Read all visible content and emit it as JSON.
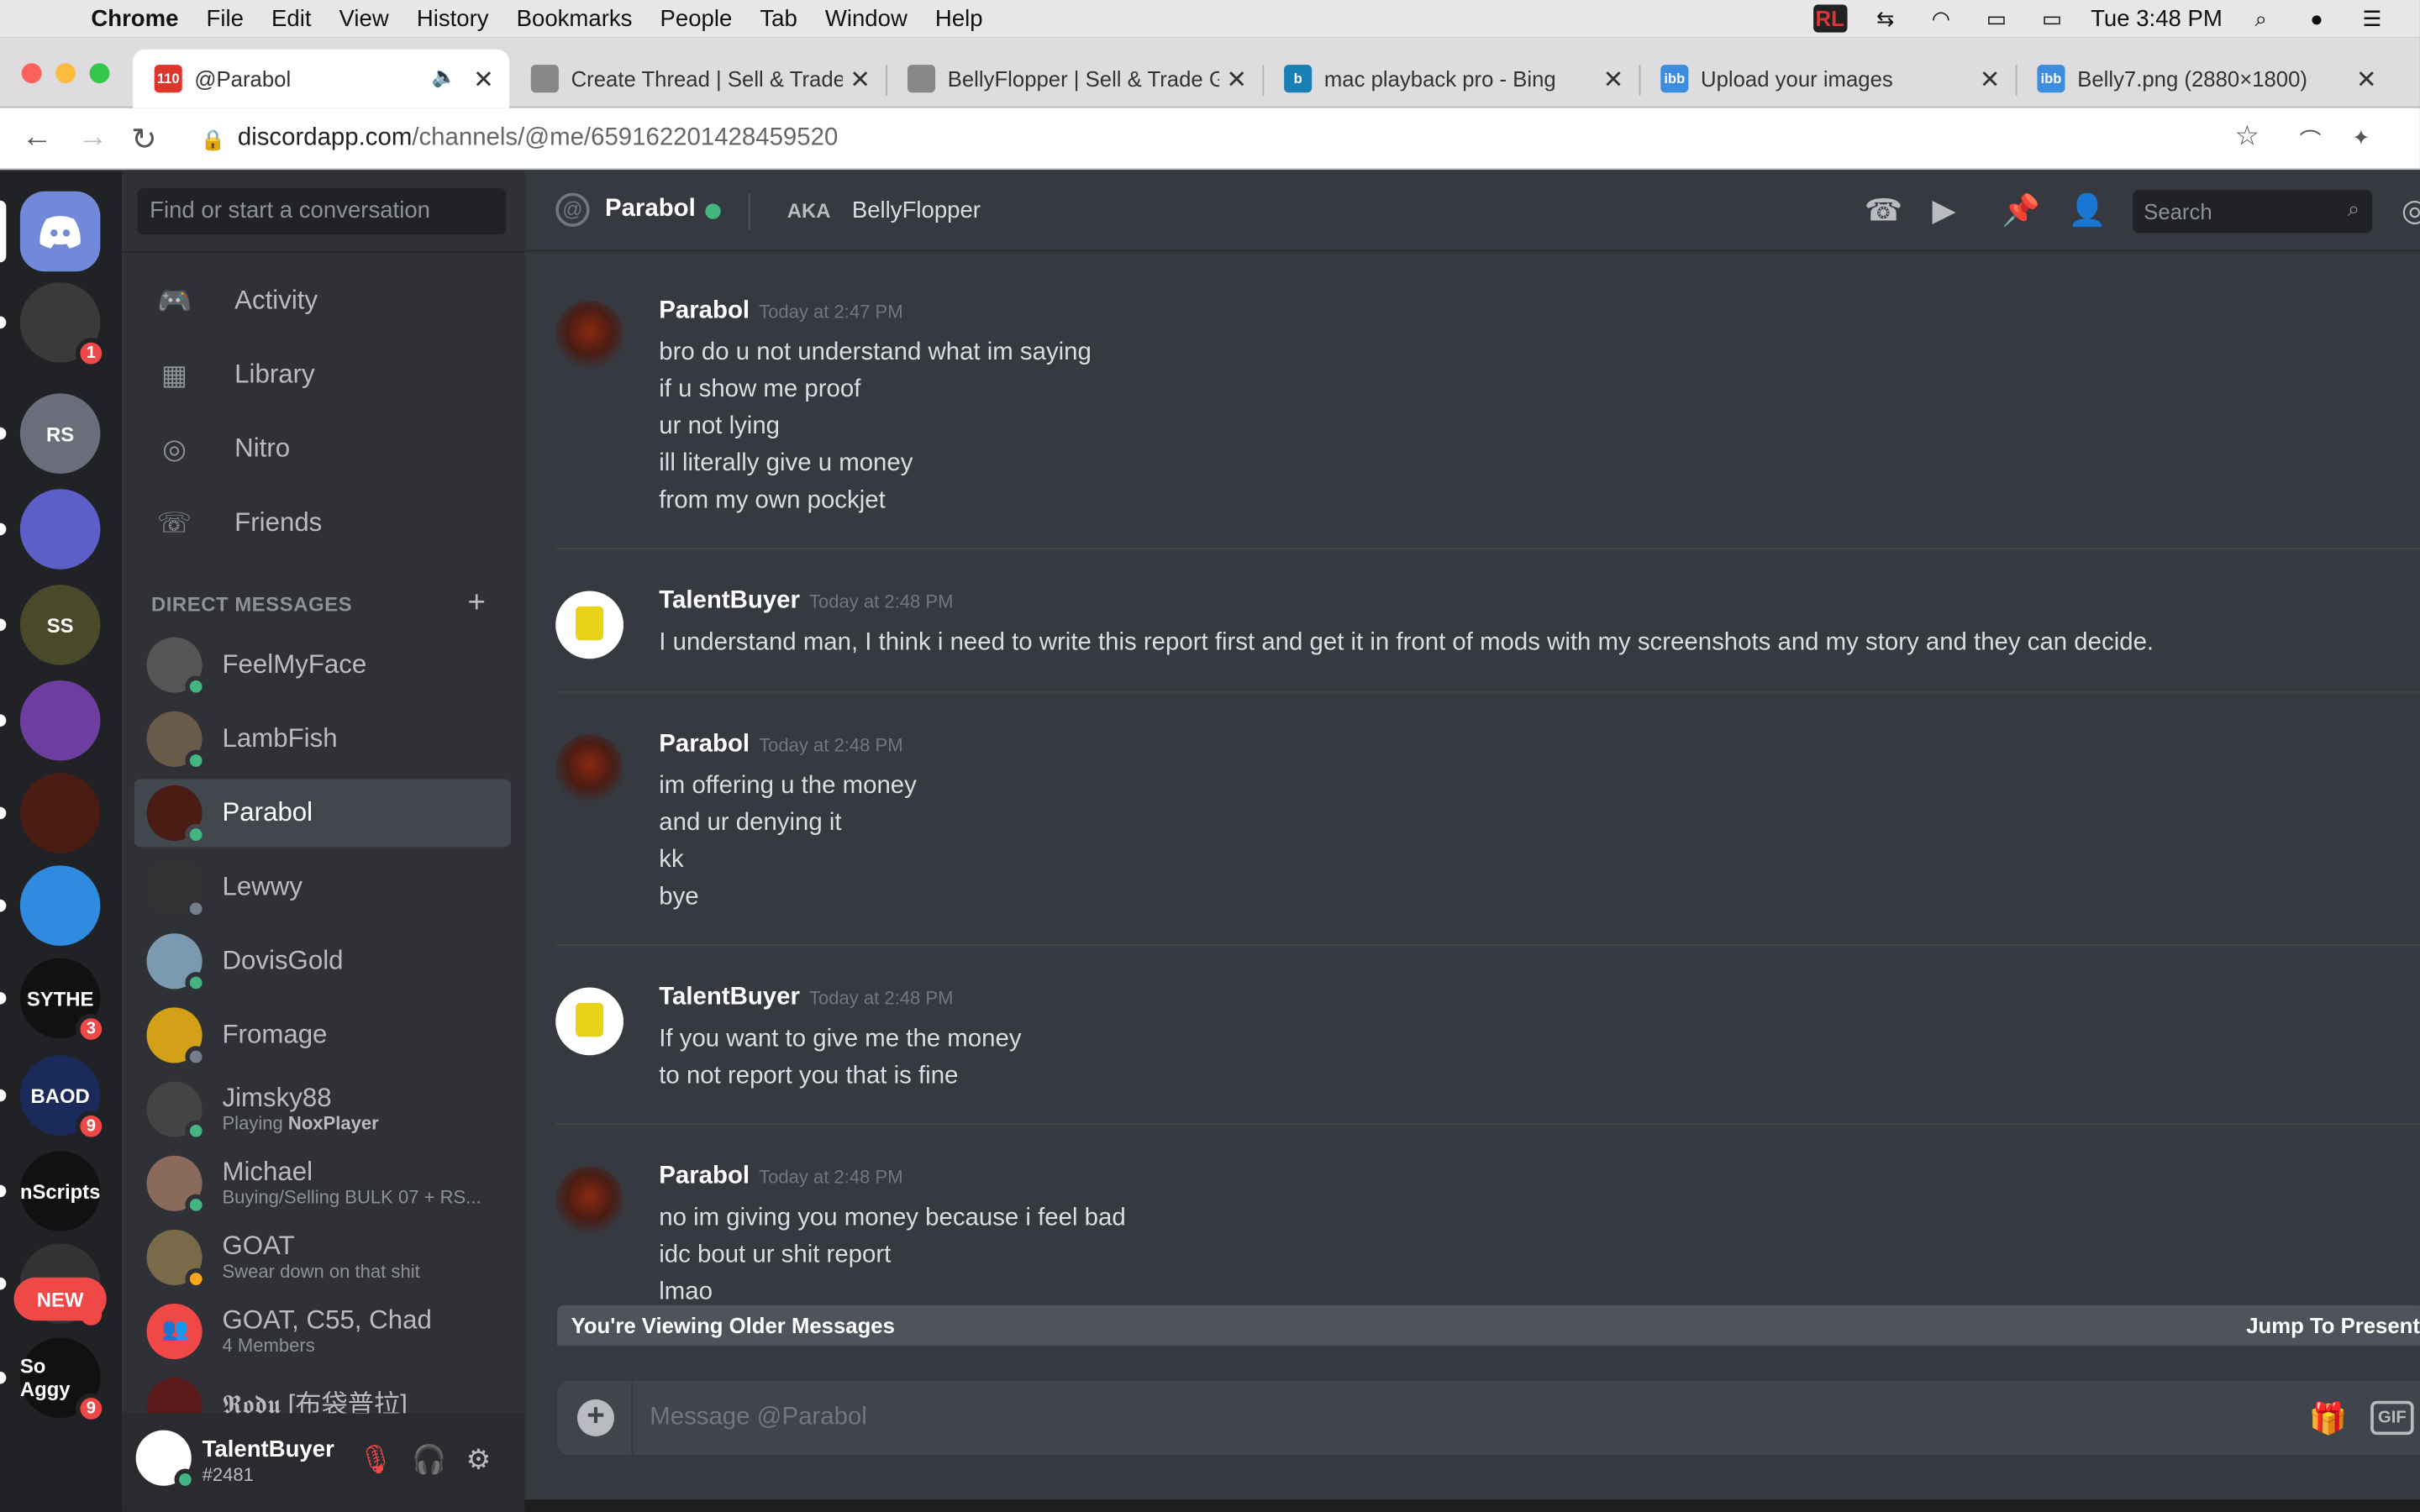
{
  "menubar": {
    "app": "Chrome",
    "items": [
      "File",
      "Edit",
      "View",
      "History",
      "Bookmarks",
      "People",
      "Tab",
      "Window",
      "Help"
    ],
    "clock": "Tue 3:48 PM",
    "rl_label": "RL"
  },
  "tabs": [
    {
      "title": "@Parabol",
      "badge": "110",
      "fav_color": "#e0352b"
    },
    {
      "title": "Create Thread | Sell & Trade",
      "fav_color": "#888"
    },
    {
      "title": "BellyFlopper | Sell & Trade G",
      "fav_color": "#888"
    },
    {
      "title": "mac playback pro - Bing",
      "fav_color": "#1a7fb5",
      "fav_text": "b"
    },
    {
      "title": "Upload your images",
      "fav_color": "#3c8dde",
      "fav_text": "ibb"
    },
    {
      "title": "Belly7.png (2880×1800)",
      "fav_color": "#3c8dde",
      "fav_text": "ibb"
    }
  ],
  "address": {
    "host": "discordapp.com",
    "path": "/channels/@me/659162201428459520"
  },
  "servers": [
    {
      "label": "",
      "color": "#7289da",
      "badge": ""
    },
    {
      "label": "",
      "color": "#3a3a3a",
      "badge": "1"
    },
    {
      "label": "RS",
      "color": "#6a6e7a",
      "badge": ""
    },
    {
      "label": "",
      "color": "#5b5fc7",
      "badge": ""
    },
    {
      "label": "SS",
      "color": "#4a4a2a",
      "badge": ""
    },
    {
      "label": "",
      "color": "#6d3ea0",
      "badge": ""
    },
    {
      "label": "",
      "color": "#4a1c14",
      "badge": ""
    },
    {
      "label": "",
      "color": "#2f8be0",
      "badge": ""
    },
    {
      "label": "SYTHE",
      "color": "#111",
      "badge": "3"
    },
    {
      "label": "BAOD",
      "color": "#1a2a5a",
      "badge": "9"
    },
    {
      "label": "nScripts",
      "color": "#111",
      "badge": ""
    },
    {
      "label": "",
      "color": "#333",
      "badge": "5"
    },
    {
      "label": "So Aggy",
      "color": "#111",
      "badge": "9"
    }
  ],
  "new_label": "NEW",
  "sidebar": {
    "search_placeholder": "Find or start a conversation",
    "nav": [
      "Activity",
      "Library",
      "Nitro",
      "Friends"
    ],
    "dm_header": "DIRECT MESSAGES",
    "dms": [
      {
        "name": "FeelMyFace",
        "sub": "",
        "status": "on",
        "color": "#555"
      },
      {
        "name": "LambFish",
        "sub": "",
        "status": "on",
        "color": "#6a5a4a"
      },
      {
        "name": "Parabol",
        "sub": "",
        "status": "on",
        "color": "#4a1c14"
      },
      {
        "name": "Lewwy",
        "sub": "",
        "status": "off",
        "color": "#333"
      },
      {
        "name": "DovisGold",
        "sub": "",
        "status": "on",
        "color": "#7a9ab0"
      },
      {
        "name": "Fromage",
        "sub": "",
        "status": "off",
        "color": "#d4a017"
      },
      {
        "name": "Jimsky88",
        "sub_prefix": "Playing ",
        "sub_bold": "NoxPlayer",
        "status": "on",
        "color": "#444"
      },
      {
        "name": "Michael",
        "sub": "Buying/Selling BULK 07 + RS...",
        "status": "on",
        "color": "#8a6a5a"
      },
      {
        "name": "GOAT",
        "sub": "Swear down on that shit",
        "status": "idle",
        "color": "#7a6a4a"
      },
      {
        "name": "GOAT, C55, Chad",
        "sub": "4 Members",
        "status": "none",
        "color": "#f04747"
      },
      {
        "name": "𝕽𝖔𝖉𝖚 [布袋普拉]",
        "sub": "",
        "status": "none",
        "color": "#5a1a1a"
      }
    ]
  },
  "user": {
    "name": "TalentBuyer",
    "tag": "#2481"
  },
  "chat": {
    "channel": "Parabol",
    "aka": "AKA",
    "aka_name": "BellyFlopper",
    "search_placeholder": "Search",
    "messages": [
      {
        "author": "Parabol",
        "time": "Today at 2:47 PM",
        "lines": [
          "bro do u not understand what im saying",
          "if u show me proof",
          "ur not lying",
          "ill literally give u money",
          "from my own pockjet"
        ]
      },
      {
        "author": "TalentBuyer",
        "time": "Today at 2:48 PM",
        "lines": [
          "I understand man, I think i need to write this report first and get it in front of mods with my screenshots and my story and they can decide."
        ]
      },
      {
        "author": "Parabol",
        "time": "Today at 2:48 PM",
        "lines": [
          "im offering u the money",
          "and ur denying it",
          "kk",
          "bye"
        ]
      },
      {
        "author": "TalentBuyer",
        "time": "Today at 2:48 PM",
        "lines": [
          "If you want to give me the money",
          "to not report you that is fine"
        ]
      },
      {
        "author": "Parabol",
        "time": "Today at 2:48 PM",
        "lines": [
          "no im giving you money because i feel bad",
          "idc bout ur shit report",
          "lmao"
        ]
      }
    ],
    "older_notice": "You're Viewing Older Messages",
    "jump_label": "Jump To Present",
    "composer_placeholder": "Message @Parabol",
    "gif_label": "GIF"
  }
}
